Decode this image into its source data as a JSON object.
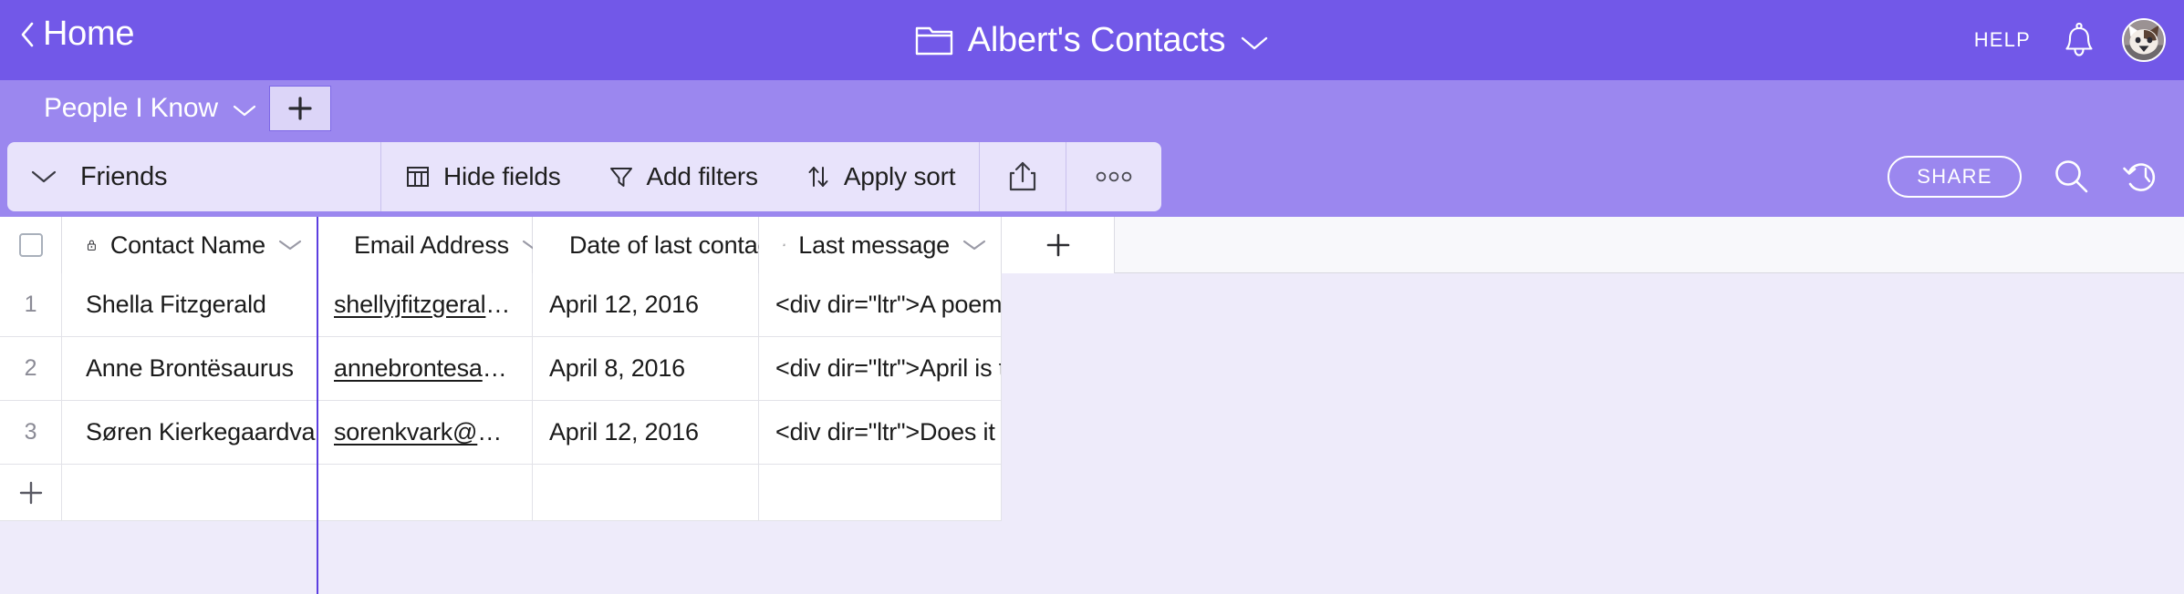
{
  "topbar": {
    "home_label": "Home",
    "base_title": "Albert's Contacts",
    "help_label": "HELP"
  },
  "tabs": {
    "active_label": "People I Know",
    "add_tab_label": "+"
  },
  "toolbar": {
    "view_name": "Friends",
    "hide_fields_label": "Hide fields",
    "add_filters_label": "Add filters",
    "apply_sort_label": "Apply sort",
    "more_label": "○○○",
    "share_label": "SHARE"
  },
  "grid": {
    "columns": [
      {
        "label": "Contact Name",
        "icon": "lock-icon"
      },
      {
        "label": "Email Address",
        "icon": "envelope-icon"
      },
      {
        "label": "Date of last contact",
        "icon": "calendar-icon"
      },
      {
        "label": "Last message",
        "icon": "long-text-icon"
      }
    ],
    "add_field_label": "+",
    "add_row_label": "+",
    "rows": [
      {
        "num": "1",
        "name": "Shella Fitzgerald",
        "email": "shellyjfitzgerald@gmail.com",
        "date": "April 12, 2016",
        "message": "<div dir=\"ltr\">A poem lovely as …"
      },
      {
        "num": "2",
        "name": "Anne Brontësaurus",
        "email": "annebrontesaurus@gmail.com",
        "date": "April 8, 2016",
        "message": "<div dir=\"ltr\">April is the cruelle…"
      },
      {
        "num": "3",
        "name": "Søren Kierkegaardvark",
        "email": "sorenkvark@gmail.com",
        "date": "April 12, 2016",
        "message": "<div dir=\"ltr\">Does it dry up like…"
      }
    ]
  },
  "colors": {
    "topbar_purple": "#7258e8",
    "tabstrip_purple": "#9b87ef",
    "toolbar_chip": "#e8e3fb",
    "canvas": "#eeebfa",
    "divider_purple": "#5c3fe0"
  }
}
